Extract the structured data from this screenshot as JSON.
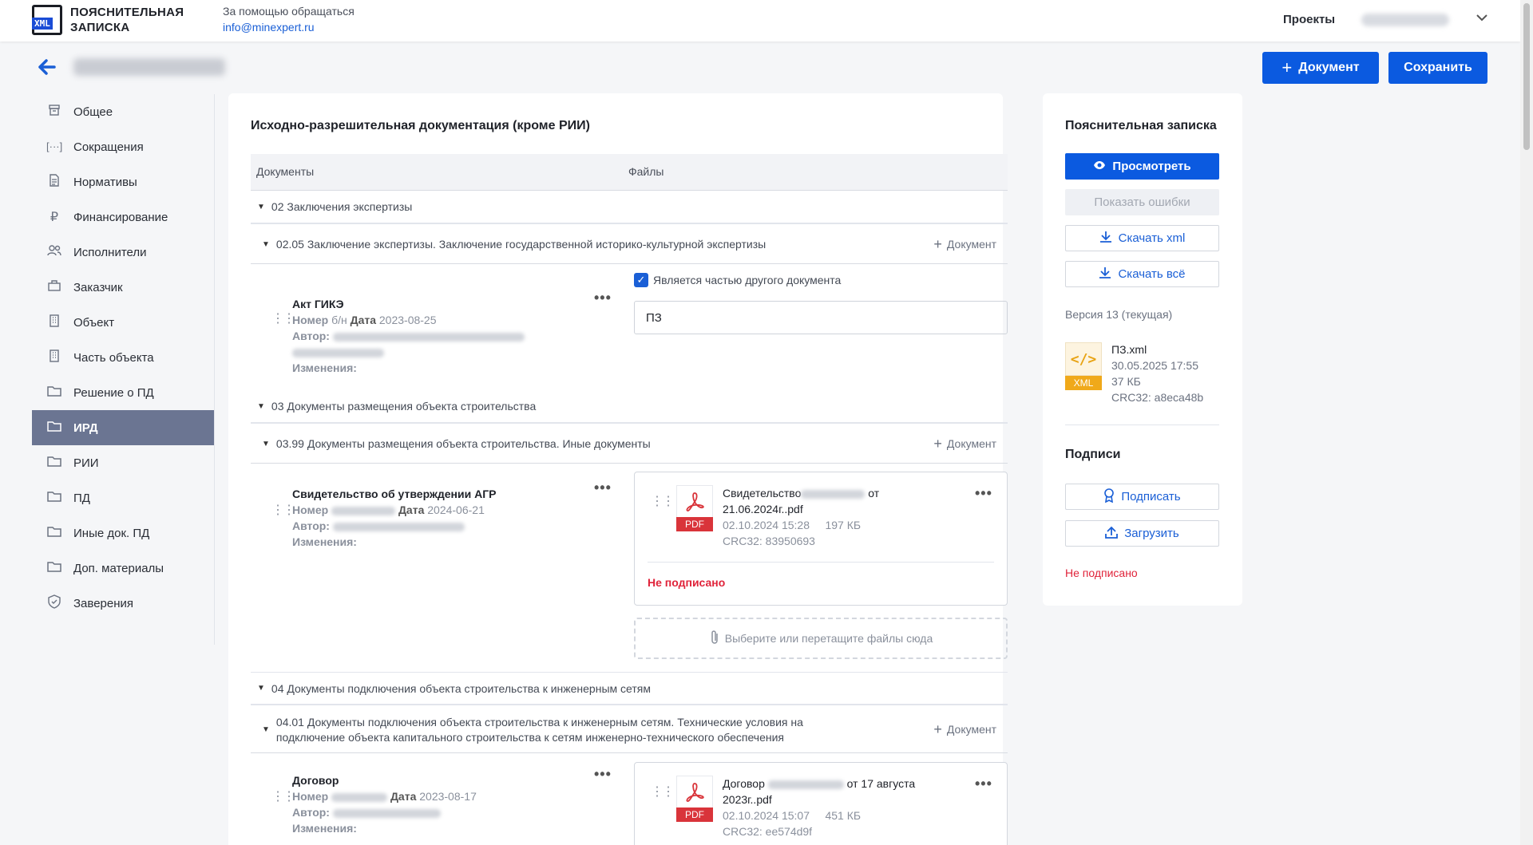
{
  "header": {
    "logo_line1": "ПОЯСНИТЕЛЬНАЯ",
    "logo_line2": "ЗАПИСКА",
    "logo_badge": "XML",
    "help_text": "За помощью обращаться",
    "help_email": "info@minexpert.ru",
    "projects_link": "Проекты"
  },
  "toolbar": {
    "add_document": "Документ",
    "save": "Сохранить"
  },
  "sidebar": {
    "items": [
      {
        "label": "Общее",
        "icon": "archive-icon"
      },
      {
        "label": "Сокращения",
        "icon": "brackets-icon"
      },
      {
        "label": "Нормативы",
        "icon": "document-icon"
      },
      {
        "label": "Финансирование",
        "icon": "ruble-icon"
      },
      {
        "label": "Исполнители",
        "icon": "users-icon"
      },
      {
        "label": "Заказчик",
        "icon": "briefcase-icon"
      },
      {
        "label": "Объект",
        "icon": "building-icon"
      },
      {
        "label": "Часть объекта",
        "icon": "building-icon"
      },
      {
        "label": "Решение о ПД",
        "icon": "folder-icon"
      },
      {
        "label": "ИРД",
        "icon": "folder-icon"
      },
      {
        "label": "РИИ",
        "icon": "folder-icon"
      },
      {
        "label": "ПД",
        "icon": "folder-icon"
      },
      {
        "label": "Иные док. ПД",
        "icon": "folder-icon"
      },
      {
        "label": "Доп. материалы",
        "icon": "folder-icon"
      },
      {
        "label": "Заверения",
        "icon": "shield-check-icon"
      }
    ],
    "active_index": 9
  },
  "main": {
    "title": "Исходно-разрешительная документация (кроме РИИ)",
    "col_documents": "Документы",
    "col_files": "Файлы",
    "add_document_label": "Документ",
    "sections": [
      {
        "label": "02 Заключения экспертизы"
      },
      {
        "label": "03 Документы размещения объекта строительства"
      },
      {
        "label": "04 Документы подключения объекта строительства к инженерным сетям"
      }
    ],
    "subsections": [
      {
        "label": "02.05 Заключение экспертизы. Заключение государственной историко-культурной экспертизы"
      },
      {
        "label": "03.99 Документы размещения объекта строительства. Иные документы"
      },
      {
        "label": "04.01 Документы подключения объекта строительства к инженерным сетям. Технические условия на подключение объекта капитального строительства к сетям инженерно-технического обеспечения"
      }
    ],
    "docs": [
      {
        "title": "Акт ГИКЭ",
        "number_label": "Номер",
        "number": "б/н",
        "date_label": "Дата",
        "date": "2023-08-25",
        "author_label": "Автор:",
        "changes_label": "Изменения:"
      },
      {
        "title": "Свидетельство об утверждении АГР",
        "number_label": "Номер",
        "date_label": "Дата",
        "date": "2024-06-21",
        "author_label": "Автор:",
        "changes_label": "Изменения:"
      },
      {
        "title": "Договор",
        "number_label": "Номер",
        "date_label": "Дата",
        "date": "2023-08-17",
        "author_label": "Автор:",
        "changes_label": "Изменения:"
      }
    ],
    "part_of_other": {
      "label": "Является частью другого документа",
      "checked": true,
      "value": "ПЗ"
    },
    "files": [
      {
        "name_start": "Свидетельство",
        "name_end": "от",
        "name_line2": "21.06.2024г..pdf",
        "uploaded": "02.10.2024 15:28",
        "size": "197 КБ",
        "crc": "CRC32: 83950693",
        "status": "Не подписано",
        "type": "PDF"
      },
      {
        "name_start": "Договор",
        "name_end": "от 17 августа",
        "name_line2": "2023г..pdf",
        "uploaded": "02.10.2024 15:07",
        "size": "451 КБ",
        "crc": "CRC32: ee574d9f",
        "type": "PDF"
      }
    ],
    "dropzone": "Выберите или перетащите файлы сюда"
  },
  "right": {
    "title": "Пояснительная записка",
    "view": "Просмотреть",
    "show_errors": "Показать ошибки",
    "download_xml": "Скачать xml",
    "download_all": "Скачать всё",
    "version": "Версия 13 (текущая)",
    "file": {
      "name": "ПЗ.xml",
      "date": "30.05.2025 17:55",
      "size": "37 КБ",
      "crc": "CRC32: a8eca48b",
      "type": "XML"
    },
    "signatures_title": "Подписи",
    "sign": "Подписать",
    "upload": "Загрузить",
    "status": "Не подписано"
  },
  "colors": {
    "accent": "#0b5ae0",
    "active_sidebar": "#6b7592",
    "danger": "#e0233a",
    "pdf": "#d9343a",
    "xml": "#f0a91a"
  }
}
